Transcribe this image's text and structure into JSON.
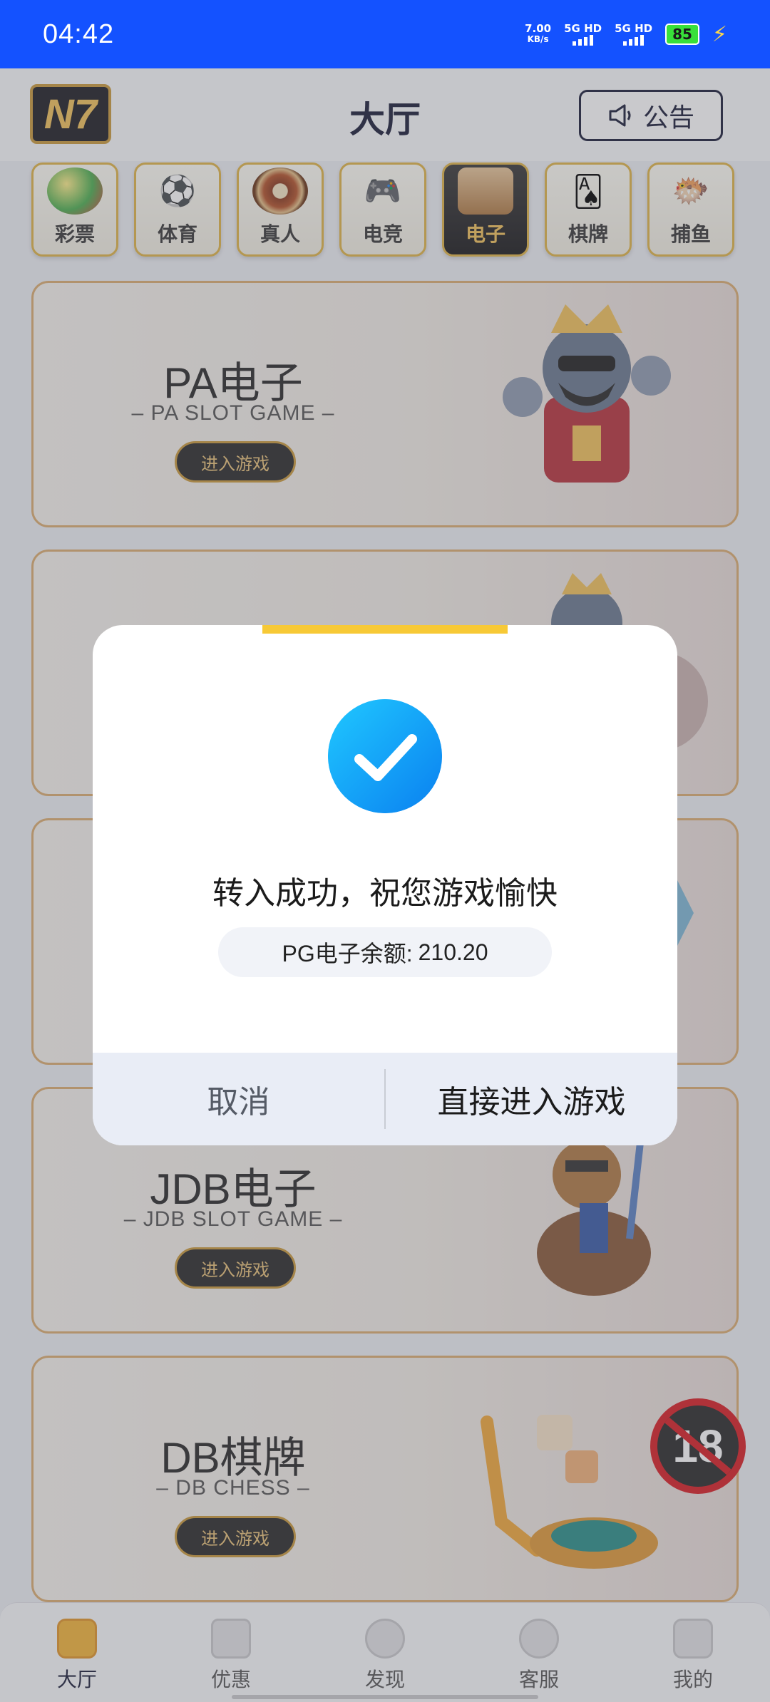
{
  "status_bar": {
    "time": "04:42",
    "net_speed_value": "7.00",
    "net_speed_unit": "KB/s",
    "sim1": "5G HD",
    "sim2": "5G HD",
    "battery": "85"
  },
  "header": {
    "logo": "N7",
    "title": "大厅",
    "notice_label": "公告"
  },
  "categories": [
    {
      "label": "彩票",
      "icon": "lottery-ball-icon",
      "active": false
    },
    {
      "label": "体育",
      "icon": "soccer-icon",
      "active": false
    },
    {
      "label": "真人",
      "icon": "roulette-icon",
      "active": false
    },
    {
      "label": "电竞",
      "icon": "gamepad-icon",
      "active": false
    },
    {
      "label": "电子",
      "icon": "slot-machine-icon",
      "active": true
    },
    {
      "label": "棋牌",
      "icon": "playing-card-icon",
      "active": false
    },
    {
      "label": "捕鱼",
      "icon": "pufferfish-icon",
      "active": false
    }
  ],
  "cards": [
    {
      "name": "PA电子",
      "subtitle": "– PA SLOT GAME –",
      "button": "进入游戏",
      "art": "king-character-icon"
    },
    {
      "name": "",
      "subtitle": "",
      "button": "",
      "art": "king-character-icon"
    },
    {
      "name": "",
      "subtitle": "",
      "button": "",
      "art": "crystal-icon"
    },
    {
      "name": "JDB电子",
      "subtitle": "– JDB SLOT GAME –",
      "button": "进入游戏",
      "art": "knight-character-icon"
    },
    {
      "name": "DB棋牌",
      "subtitle": "– DB CHESS –",
      "button": "进入游戏",
      "art": "dice-chips-icon"
    }
  ],
  "dialog": {
    "message": "转入成功，祝您游戏愉快",
    "balance_label": "PG电子余额:",
    "balance_value": "210.20",
    "cancel_label": "取消",
    "enter_label": "直接进入游戏"
  },
  "age_badge": "18",
  "bottom_nav": [
    {
      "label": "大厅",
      "icon": "lobby-icon",
      "active": true
    },
    {
      "label": "优惠",
      "icon": "gift-icon",
      "active": false
    },
    {
      "label": "发现",
      "icon": "discover-icon",
      "active": false
    },
    {
      "label": "客服",
      "icon": "headset-icon",
      "active": false
    },
    {
      "label": "我的",
      "icon": "profile-icon",
      "active": false
    }
  ],
  "colors": {
    "status_bar": "#1452ff",
    "accent_gold": "#e0b548",
    "check_blue": "#0a86f2",
    "dialog_topbar": "#f7c936"
  }
}
